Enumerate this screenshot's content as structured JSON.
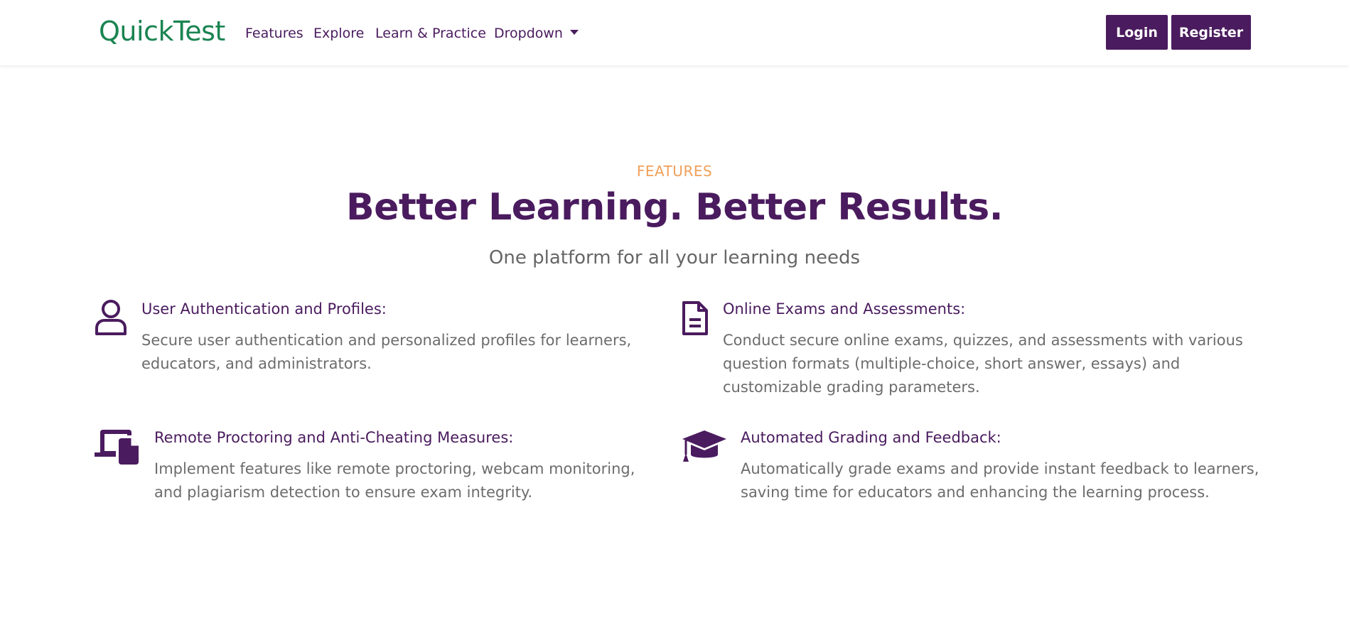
{
  "brand": "QuickTest",
  "nav": {
    "links": [
      "Features",
      "Explore",
      "Learn & Practice",
      "Dropdown"
    ],
    "login_label": "Login",
    "register_label": "Register"
  },
  "hero": {
    "eyebrow": "FEATURES",
    "title": "Better Learning. Better Results.",
    "subtitle": "One platform for all your learning needs"
  },
  "features": [
    {
      "icon": "user-icon",
      "title": "User Authentication and Profiles:",
      "description": "Secure user authentication and personalized profiles for learners, educators, and administrators."
    },
    {
      "icon": "document-icon",
      "title": "Online Exams and Assessments:",
      "description": "Conduct secure online exams, quizzes, and assessments with various question formats (multiple-choice, short answer, essays) and customizable grading parameters."
    },
    {
      "icon": "devices-icon",
      "title": "Remote Proctoring and Anti-Cheating Measures:",
      "description": "Implement features like remote proctoring, webcam monitoring, and plagiarism detection to ensure exam integrity."
    },
    {
      "icon": "graduation-cap-icon",
      "title": "Automated Grading and Feedback:",
      "description": "Automatically grade exams and provide instant feedback to learners, saving time for educators and enhancing the learning process."
    }
  ],
  "colors": {
    "primary": "#4a1b5e",
    "brand": "#1a8451",
    "accent": "#f0a05a",
    "muted_text": "#6c6c6c"
  }
}
